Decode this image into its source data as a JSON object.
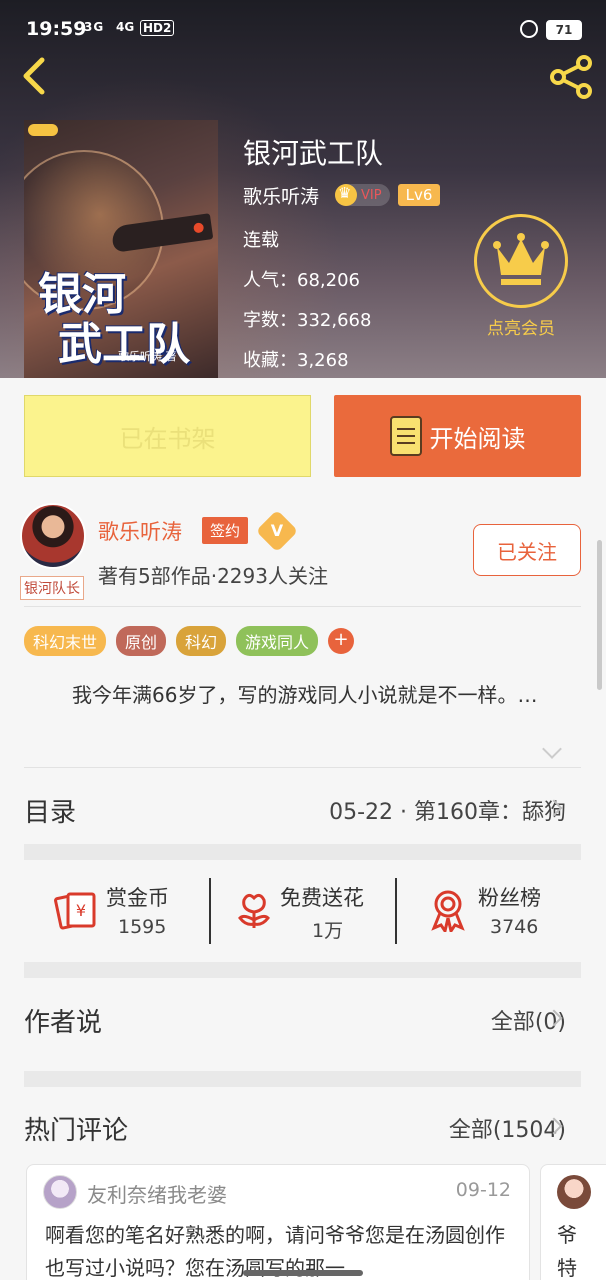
{
  "status_bar": {
    "time": "19:59",
    "net1": "3G",
    "net2": "4G",
    "hd": "HD2",
    "battery": "71"
  },
  "book": {
    "title": "银河武工队",
    "author": "歌乐听涛",
    "vip_label": "VIP",
    "level": "Lv6",
    "status": "连载",
    "popularity": "人气：68,206",
    "words": "字数：332,668",
    "favorites": "收藏：3,268",
    "cover_title_line1": "银河",
    "cover_title_line2": "武工队",
    "cover_author": "歌乐听涛 著"
  },
  "member": {
    "label": "点亮会员"
  },
  "actions": {
    "shelf_label": "已在书架",
    "read_label": "开始阅读"
  },
  "author_card": {
    "name": "歌乐听涛",
    "sign_badge": "签约",
    "verified_badge": "V",
    "team_badge": "银河队长",
    "subtitle": "著有5部作品·2293人关注",
    "follow_label": "已关注"
  },
  "tags": [
    {
      "label": "科幻末世",
      "color": "#f7b84e"
    },
    {
      "label": "原创",
      "color": "#c0695a"
    },
    {
      "label": "科幻",
      "color": "#d9a33a"
    },
    {
      "label": "游戏同人",
      "color": "#8fc15a"
    }
  ],
  "tag_add": "+",
  "description": "我今年满66岁了，写的游戏同人小说就是不一样。…",
  "toc": {
    "label": "目录",
    "latest": "05-22 · 第160章：舔狗"
  },
  "stats": [
    {
      "name": "赏金币",
      "value": "1595",
      "icon": "coin-icon"
    },
    {
      "name": "免费送花",
      "value": "1万",
      "icon": "flower-icon"
    },
    {
      "name": "粉丝榜",
      "value": "3746",
      "icon": "medal-icon"
    }
  ],
  "author_says": {
    "label": "作者说",
    "all": "全部(0)"
  },
  "hot_comments": {
    "label": "热门评论",
    "all": "全部(1504)",
    "items": [
      {
        "user": "友利奈绪我老婆",
        "date": "09-12",
        "text": "啊看您的笔名好熟悉的啊，请问爷爷您是在汤圆创作也写过小说吗？您在汤圆写的那一"
      },
      {
        "text": "爷特"
      }
    ]
  },
  "colors": {
    "accent": "#e8633c",
    "gold": "#f7cc4a",
    "shelf_bg": "#fbf38d"
  }
}
